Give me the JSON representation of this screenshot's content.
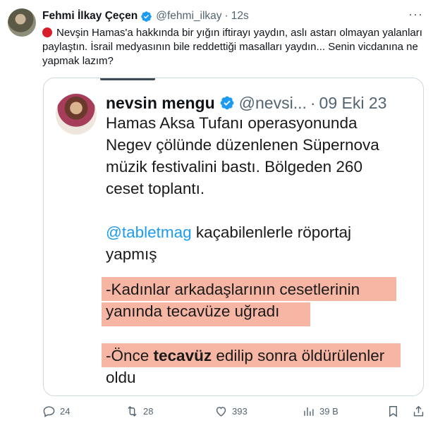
{
  "tweet": {
    "author_name": "Fehmi İlkay Çeçen",
    "handle": "@fehmi_ilkay",
    "separator": "·",
    "time": "12s",
    "more_icon": "more-icon",
    "text": "Nevşin Hamas'a hakkında bir yığın iftirayı yaydın, aslı astarı olmayan yalanları paylaştın. İsrail medyasının bile reddettiği masalları yaydın... Senin vicdanına ne yapmak lazım?"
  },
  "quote": {
    "author_name": "nevsin mengu",
    "handle": "@nevsi...",
    "separator": "·",
    "date": "09 Eki 23",
    "para1_lines": [
      "Hamas Aksa Tufanı operasyonunda",
      "Negev çölünde düzenlenen Süpernova",
      "müzik festivalini bastı. Bölgeden 260",
      "ceset toplantı."
    ],
    "mention": "@tabletmag",
    "para2_rest": " kaçabilenlerle röportaj",
    "para2_line2": "yapmış",
    "highlight1_line1": "-Kadınlar arkadaşlarının cesetlerinin",
    "highlight1_line2": "yanında tecavüze uğradı",
    "highlight2_prefix": "-Önce ",
    "highlight2_bold": "tecavüz",
    "highlight2_suffix": " edilip sonra öldürülenler",
    "highlight2_line2": "oldu"
  },
  "actions": {
    "reply_count": "24",
    "retweet_count": "28",
    "like_count": "393",
    "views_count": "39 B"
  },
  "colors": {
    "accent": "#1d9bf0",
    "highlight": "#f6a994",
    "red_circle": "#d81e2b"
  }
}
